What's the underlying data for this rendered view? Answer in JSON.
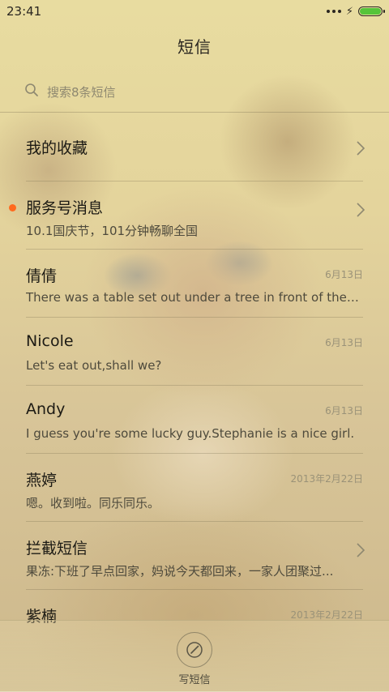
{
  "status_bar": {
    "time": "23:41"
  },
  "header": {
    "title": "短信"
  },
  "search": {
    "placeholder": "搜索8条短信"
  },
  "conversations": [
    {
      "name": "我的收藏",
      "preview": "",
      "date": "",
      "chevron": true,
      "unread": false
    },
    {
      "name": "服务号消息",
      "preview": "10.1国庆节，101分钟畅聊全国",
      "date": "",
      "chevron": true,
      "unread": true
    },
    {
      "name": "倩倩",
      "preview": "There was a table set out under a tree in front of the ho...",
      "date": "6月13日",
      "chevron": false,
      "unread": false
    },
    {
      "name": "Nicole",
      "preview": "Let's eat out,shall we?",
      "date": "6月13日",
      "chevron": false,
      "unread": false
    },
    {
      "name": "Andy",
      "preview": "I guess you're some lucky guy.Stephanie is a nice girl.",
      "date": "6月13日",
      "chevron": false,
      "unread": false
    },
    {
      "name": "燕婷",
      "preview": "嗯。收到啦。同乐同乐。",
      "date": "2013年2月22日",
      "chevron": false,
      "unread": false
    },
    {
      "name": "拦截短信",
      "preview": "果冻:下班了早点回家，妈说今天都回来，一家人团聚过...",
      "date": "",
      "chevron": true,
      "unread": false
    },
    {
      "name": "紫楠",
      "preview": "",
      "date": "2013年2月22日",
      "chevron": false,
      "unread": false
    }
  ],
  "bottom_bar": {
    "compose_label": "写短信"
  },
  "colors": {
    "unread_dot": "#ff6a1e",
    "battery": "#55c43a"
  }
}
